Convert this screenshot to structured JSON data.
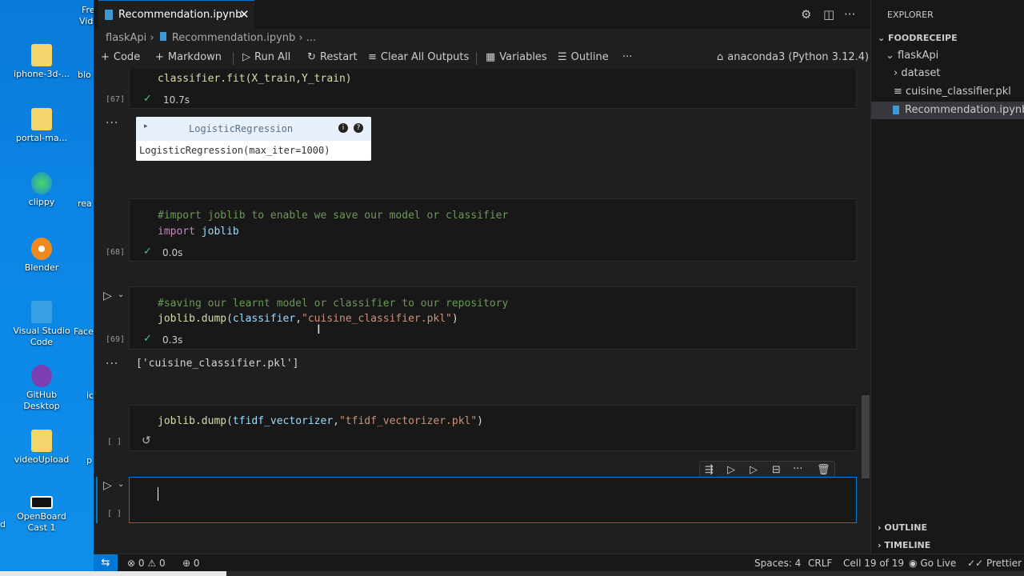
{
  "desktop": {
    "icons": [
      {
        "label": "iphone-3d-...",
        "color": "#f3d66b"
      },
      {
        "label": "portal-ma...",
        "color": "#f3d66b"
      },
      {
        "label": "clippy",
        "color": "#2fa3e0"
      },
      {
        "label": "Blender",
        "color": "#f08a1c"
      },
      {
        "label": "Visual Studio Code",
        "color": "#3aa0e6"
      },
      {
        "label": "GitHub Desktop",
        "color": "#7b3fb2"
      },
      {
        "label": "videoUpload",
        "color": "#f3d66b"
      },
      {
        "label": "OpenBoard Cast 1",
        "color": "#1a1a1a"
      }
    ],
    "cut_labels": [
      "Fre",
      "Vid",
      "blo",
      "rea",
      "Face",
      "ic",
      "p",
      "d"
    ]
  },
  "tab": {
    "title": "Recommendation.ipynb",
    "close": "✕"
  },
  "breadcrumb": {
    "folder": "flaskApi",
    "file": "Recommendation.ipynb",
    "more": "..."
  },
  "toolbar": {
    "code": "Code",
    "markdown": "Markdown",
    "run_all": "Run All",
    "restart": "Restart",
    "clear_outputs": "Clear All Outputs",
    "variables": "Variables",
    "outline": "Outline",
    "more": "···",
    "kernel": "anaconda3 (Python 3.12.4)"
  },
  "cells": {
    "c67": {
      "code": "classifier.fit(X_train,Y_train)",
      "exec": "[67]",
      "time": "10.7s"
    },
    "out67": {
      "widget_title": "LogisticRegression",
      "widget_repr": "LogisticRegression(max_iter=1000)"
    },
    "c68": {
      "comment": "#import joblib to enable we save our model or classifier",
      "kw": "import",
      "module": "joblib",
      "exec": "[68]",
      "time": "0.0s"
    },
    "c69": {
      "comment": "#saving our learnt model or classifier to our repository",
      "fn": "joblib.dump",
      "arg": "classifier",
      "str": "\"cuisine_classifier.pkl\"",
      "exec": "[69]",
      "time": "0.3s",
      "output": "['cuisine_classifier.pkl']"
    },
    "c70": {
      "fn": "joblib.dump",
      "arg": "tfidf_vectorizer",
      "str": "\"tfidf_vectorizer.pkl\"",
      "exec": "[ ]"
    },
    "c71": {
      "exec": "[ ]"
    }
  },
  "explorer": {
    "header": "EXPLORER",
    "project": "FOODRECEIPE",
    "folder": "flaskApi",
    "items": [
      "dataset",
      "cuisine_classifier.pkl",
      "Recommendation.ipynb"
    ],
    "outline": "OUTLINE",
    "timeline": "TIMELINE"
  },
  "statusbar": {
    "errors": "0",
    "warnings": "0",
    "ports": "0",
    "spaces": "Spaces: 4",
    "eol": "CRLF",
    "cell": "Cell 19 of 19",
    "golive": "Go Live",
    "prettier": "Prettier"
  },
  "colors": {
    "accent": "#0078d4",
    "success": "#4ec47a"
  }
}
